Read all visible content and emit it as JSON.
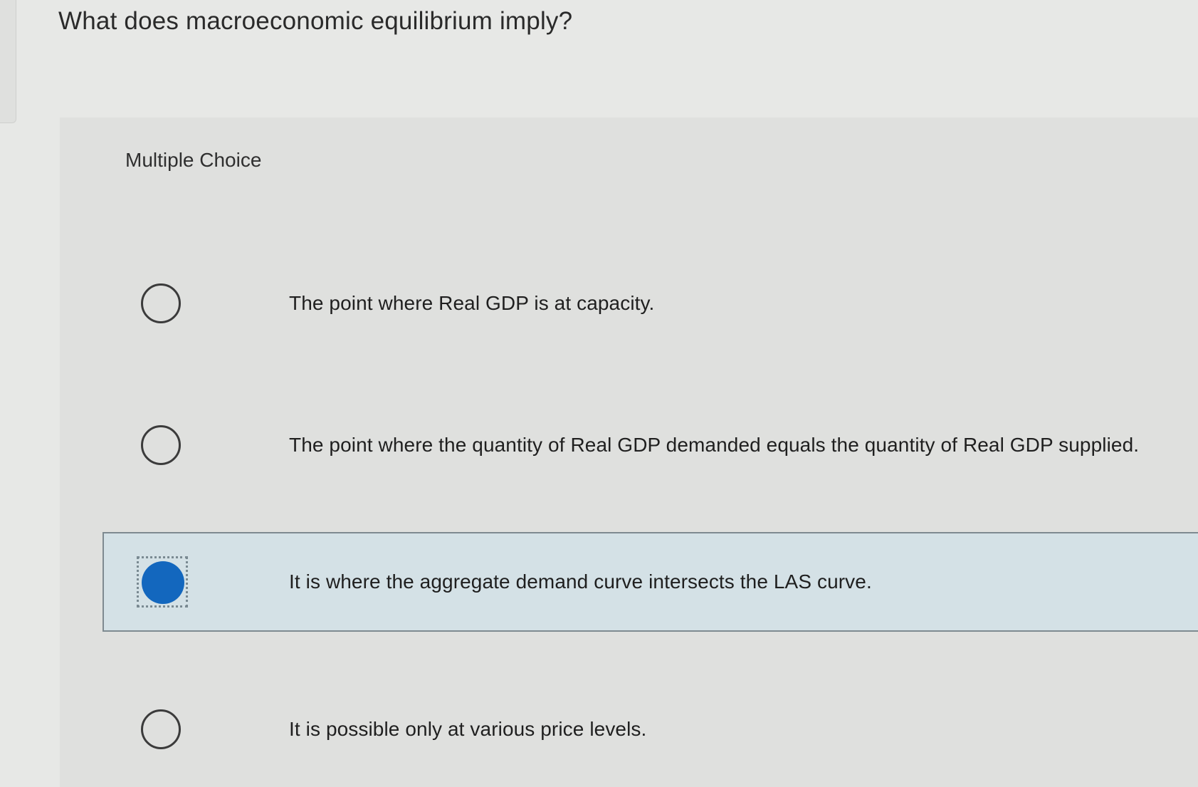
{
  "question": {
    "title": "What does macroeconomic equilibrium imply?"
  },
  "panel": {
    "heading": "Multiple Choice"
  },
  "options": [
    {
      "label": "The point where Real GDP is at capacity.",
      "selected": false
    },
    {
      "label": "The point where the quantity of Real GDP demanded equals the quantity of Real GDP supplied.",
      "selected": false
    },
    {
      "label": "It is where the aggregate demand curve intersects the LAS curve.",
      "selected": true
    },
    {
      "label": "It is possible only at various price levels.",
      "selected": false
    }
  ],
  "colors": {
    "selected_radio": "#1367be",
    "selected_background": "#d4e1e6",
    "page_background": "#e7e8e6"
  }
}
